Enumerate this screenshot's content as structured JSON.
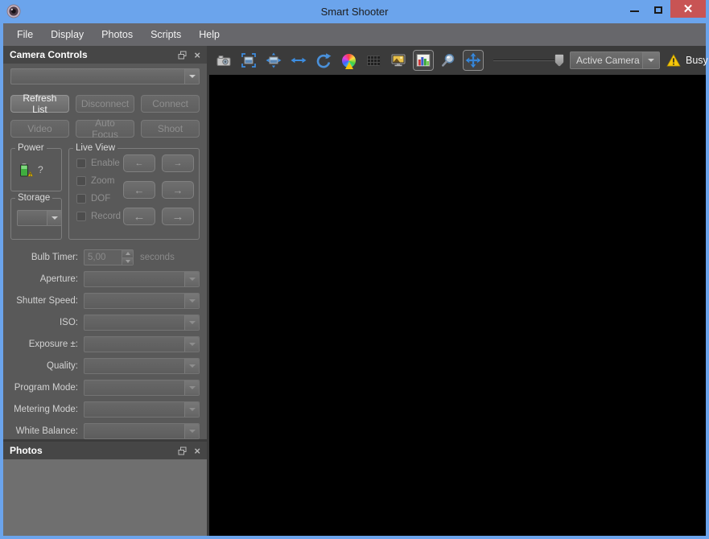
{
  "window": {
    "title": "Smart Shooter"
  },
  "menu": {
    "items": [
      "File",
      "Display",
      "Photos",
      "Scripts",
      "Help"
    ]
  },
  "camera_controls": {
    "title": "Camera Controls",
    "camera_select_value": "",
    "buttons": [
      {
        "label": "Refresh List",
        "enabled": true
      },
      {
        "label": "Disconnect",
        "enabled": false
      },
      {
        "label": "Connect",
        "enabled": false
      },
      {
        "label": "Video",
        "enabled": false
      },
      {
        "label": "Auto Focus",
        "enabled": false
      },
      {
        "label": "Shoot",
        "enabled": false
      }
    ],
    "power_group": {
      "label": "Power",
      "status": "?"
    },
    "storage_group": {
      "label": "Storage",
      "select_value": ""
    },
    "live_view_group": {
      "label": "Live View",
      "checkboxes": [
        "Enable",
        "Zoom",
        "DOF",
        "Record"
      ]
    },
    "bulb_timer": {
      "label": "Bulb Timer:",
      "value": "5,00",
      "unit": "seconds"
    },
    "settings": [
      {
        "label": "Aperture:",
        "value": ""
      },
      {
        "label": "Shutter Speed:",
        "value": ""
      },
      {
        "label": "ISO:",
        "value": ""
      },
      {
        "label": "Exposure ±:",
        "value": ""
      },
      {
        "label": "Quality:",
        "value": ""
      },
      {
        "label": "Program Mode:",
        "value": ""
      },
      {
        "label": "Metering Mode:",
        "value": ""
      },
      {
        "label": "White Balance:",
        "value": ""
      }
    ]
  },
  "photos_panel": {
    "title": "Photos"
  },
  "toolbar": {
    "camera_select": {
      "value": "Active Camera"
    },
    "status": {
      "label": "Busy"
    }
  },
  "colors": {
    "titlebar": "#6BA4EC",
    "close_button": "#C85454",
    "menubar": "#67676B",
    "panel": "#595959",
    "panel_header": "#464646",
    "photos_body": "#6F6F6F",
    "toolbar": "#3B3B3B",
    "viewport": "#000000",
    "accent_blue": "#3D8DE0",
    "warning_yellow": "#F5C60A"
  }
}
